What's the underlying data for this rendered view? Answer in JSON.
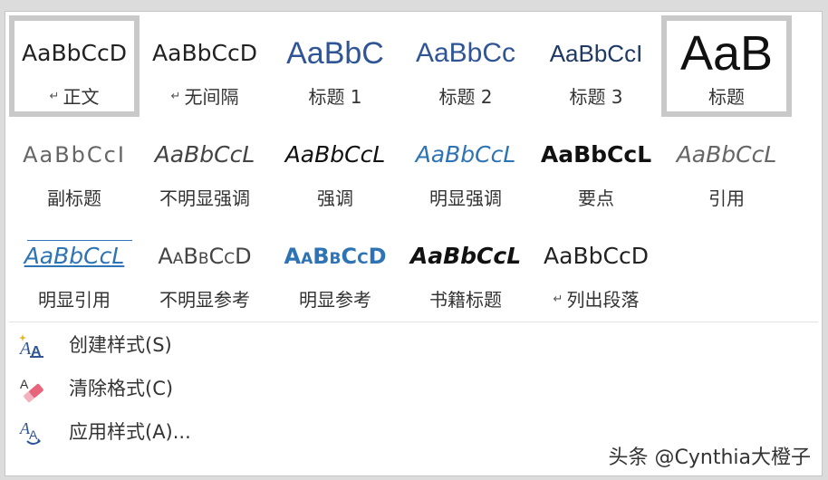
{
  "styles_gallery": {
    "rows": [
      [
        {
          "sample": "AaBbCcD",
          "label": "正文",
          "para_mark": "↵",
          "selected": true
        },
        {
          "sample": "AaBbCcD",
          "label": "无间隔",
          "para_mark": "↵",
          "selected": false
        },
        {
          "sample": "AaBbC",
          "label": "标题 1",
          "selected": false
        },
        {
          "sample": "AaBbCc",
          "label": "标题 2",
          "selected": false
        },
        {
          "sample": "AaBbCcI",
          "label": "标题 3",
          "selected": false
        },
        {
          "sample": "AaB",
          "label": "标题",
          "selected": true
        }
      ],
      [
        {
          "sample": "AaBbCcI",
          "label": "副标题"
        },
        {
          "sample": "AaBbCcL",
          "label": "不明显强调"
        },
        {
          "sample": "AaBbCcL",
          "label": "强调"
        },
        {
          "sample": "AaBbCcL",
          "label": "明显强调"
        },
        {
          "sample": "AaBbCcL",
          "label": "要点"
        },
        {
          "sample": "AaBbCcL",
          "label": "引用"
        }
      ],
      [
        {
          "sample": "AaBbCcL",
          "label": "明显引用"
        },
        {
          "sample": "AaBbCcD",
          "label": "不明显参考"
        },
        {
          "sample": "AaBbCcD",
          "label": "明显参考"
        },
        {
          "sample": "AaBbCcL",
          "label": "书籍标题"
        },
        {
          "sample": "AaBbCcD",
          "label": "列出段落",
          "para_mark": "↵"
        }
      ]
    ]
  },
  "menu": {
    "create_style": {
      "label": "创建样式(S)",
      "icon": "create-style-icon"
    },
    "clear_formatting": {
      "label": "清除格式(C)",
      "icon": "eraser-icon"
    },
    "apply_styles": {
      "label": "应用样式(A)...",
      "icon": "apply-styles-icon"
    }
  },
  "watermark": "头条 @Cynthia大橙子",
  "colors": {
    "heading_blue": "#2f5597",
    "selection_border": "#c9c9c9",
    "eraser_pink": "#e8647a"
  }
}
